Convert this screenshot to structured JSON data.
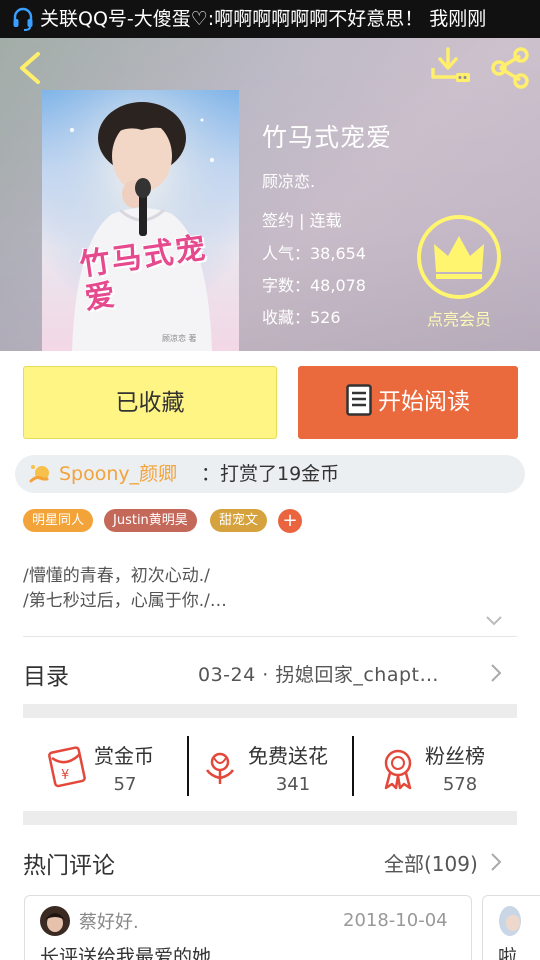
{
  "status_bar": {
    "notification_text": "关联QQ号-大傻蛋♡:啊啊啊啊啊啊不好意思！ 我刚刚"
  },
  "book": {
    "title": "竹马式宠爱",
    "author": "顾凉恋.",
    "status": "签约 | 连载",
    "popularity": "人气：38,654",
    "word_count": "字数：48,078",
    "favorites": "收藏：526",
    "cover_title_art": "竹马式宠爱",
    "cover_caption": "顾凉恋 著"
  },
  "vip": {
    "label": "点亮会员",
    "icon": "crown-icon"
  },
  "actions": {
    "collected_label": "已收藏",
    "read_label": "开始阅读"
  },
  "tip": {
    "user": "Spoony_颜卿",
    "message": "：打赏了19金币"
  },
  "tags": [
    {
      "label": "明星同人",
      "color": "#f2a33a"
    },
    {
      "label": "Justin黄明昊",
      "color": "#c4685a"
    },
    {
      "label": "甜宠文",
      "color": "#d5a23d"
    }
  ],
  "tag_add": "+",
  "description": [
    "/懵懂的青春，初次心动./",
    "/第七秒过后，心属于你./…"
  ],
  "toc": {
    "label": "目录",
    "latest": "03-24 · 拐媳回家_chapt…"
  },
  "stats": [
    {
      "label": "赏金币",
      "value": "57",
      "icon": "red-envelope-icon"
    },
    {
      "label": "免费送花",
      "value": "341",
      "icon": "flower-icon"
    },
    {
      "label": "粉丝榜",
      "value": "578",
      "icon": "award-ribbon-icon"
    }
  ],
  "comments": {
    "label": "热门评论",
    "all_label": "全部(109)",
    "items": [
      {
        "user": "蔡好好.",
        "date": "2018-10-04",
        "text": "长评送给我最爱的她"
      },
      {
        "user": "",
        "date": "",
        "text": "啦"
      }
    ]
  },
  "colors": {
    "accent_orange": "#ea6a3e",
    "collected_yellow": "#fff584",
    "tip_user": "#f2a33a"
  }
}
